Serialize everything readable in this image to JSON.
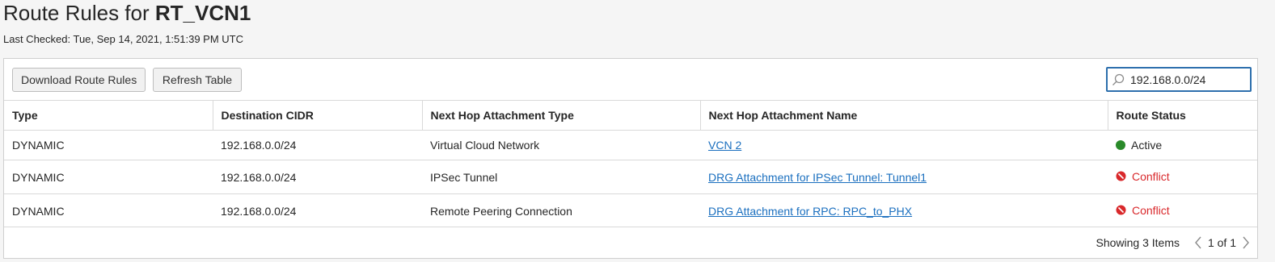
{
  "header": {
    "title_prefix": "Route Rules for",
    "route_table_name": "RT_VCN1",
    "last_checked": "Last Checked: Tue, Sep 14, 2021, 1:51:39 PM UTC"
  },
  "toolbar": {
    "download_label": "Download Route Rules",
    "refresh_label": "Refresh Table",
    "search_value": "192.168.0.0/24",
    "search_icon": "search-icon"
  },
  "table": {
    "columns": [
      "Type",
      "Destination CIDR",
      "Next Hop Attachment Type",
      "Next Hop Attachment Name",
      "Route Status"
    ],
    "rows": [
      {
        "type": "DYNAMIC",
        "cidr": "192.168.0.0/24",
        "hop_type": "Virtual Cloud Network",
        "hop_name": "VCN 2",
        "status": "Active"
      },
      {
        "type": "DYNAMIC",
        "cidr": "192.168.0.0/24",
        "hop_type": "IPSec Tunnel",
        "hop_name": "DRG Attachment for IPSec Tunnel: Tunnel1",
        "status": "Conflict"
      },
      {
        "type": "DYNAMIC",
        "cidr": "192.168.0.0/24",
        "hop_type": "Remote Peering Connection",
        "hop_name": "DRG Attachment for RPC: RPC_to_PHX",
        "status": "Conflict"
      }
    ]
  },
  "footer": {
    "showing": "Showing 3 Items",
    "page_info": "1 of 1"
  },
  "colors": {
    "active": "#2a8a2a",
    "conflict": "#d9282b",
    "link": "#1a6fbf",
    "search_border": "#2d6fad"
  }
}
